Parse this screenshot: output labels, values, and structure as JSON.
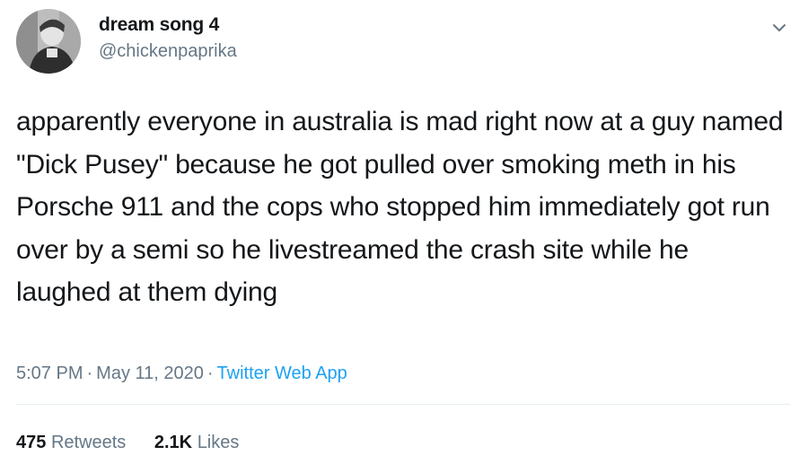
{
  "user": {
    "display_name": "dream song 4",
    "handle": "@chickenpaprika",
    "avatar_icon": "profile-photo"
  },
  "tweet": {
    "text": "apparently everyone in australia is mad right now at a guy named \"Dick Pusey\" because he got pulled over smoking meth in his Porsche 911 and the cops who stopped him immediately got run over by a semi so he livestreamed the crash site while he laughed at them dying",
    "time": "5:07 PM",
    "separator": "·",
    "date": "May 11, 2020",
    "source": "Twitter Web App"
  },
  "stats": {
    "retweets_count": "475",
    "retweets_label": "Retweets",
    "likes_count": "2.1K",
    "likes_label": "Likes"
  },
  "colors": {
    "text": "#14171a",
    "secondary": "#657786",
    "link": "#1da1f2",
    "divider": "#e6ecf0"
  },
  "icons": {
    "menu": "chevron-down-icon"
  }
}
